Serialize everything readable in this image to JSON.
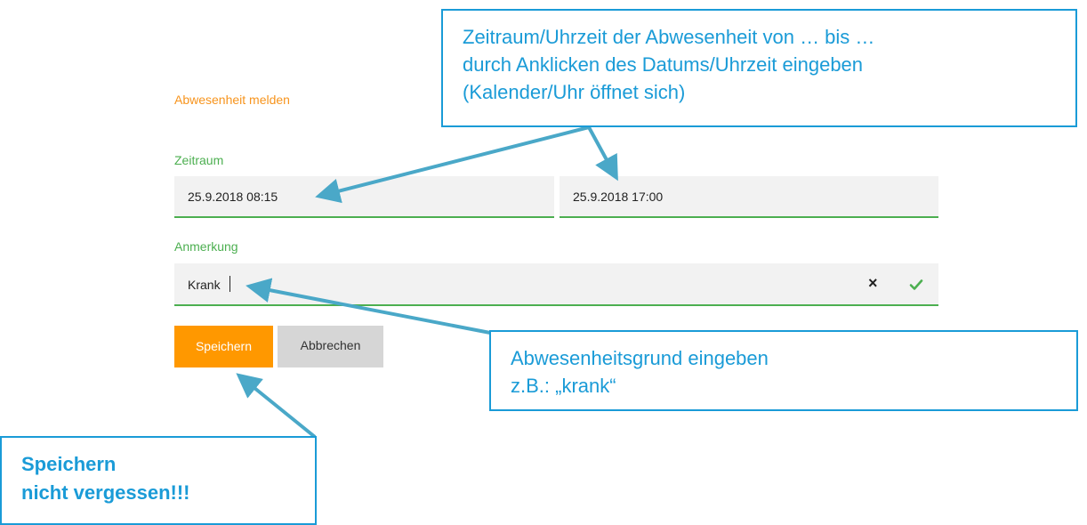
{
  "form": {
    "title": "Abwesenheit melden",
    "zeitraum_label": "Zeitraum",
    "date_from": "25.9.2018 08:15",
    "date_to": "25.9.2018 17:00",
    "anmerkung_label": "Anmerkung",
    "note_value": "Krank",
    "clear_glyph": "×",
    "save_label": "Speichern",
    "cancel_label": "Abbrechen"
  },
  "callouts": {
    "top": [
      "Zeitraum/Uhrzeit der Abwesenheit von … bis …",
      "durch Anklicken des Datums/Uhrzeit eingeben",
      "(Kalender/Uhr öffnet sich)"
    ],
    "right": [
      "Abwesenheitsgrund eingeben",
      "z.B.: „krank“"
    ],
    "left": [
      "Speichern",
      "nicht vergessen!!!"
    ]
  },
  "colors": {
    "accent_orange": "#ff9800",
    "title_orange": "#f7941d",
    "label_green": "#4caf50",
    "callout_blue": "#1a9bd7",
    "arrow_blue": "#4aa8c8"
  },
  "icons": {
    "clear": "close-icon",
    "confirm": "checkmark-icon"
  }
}
